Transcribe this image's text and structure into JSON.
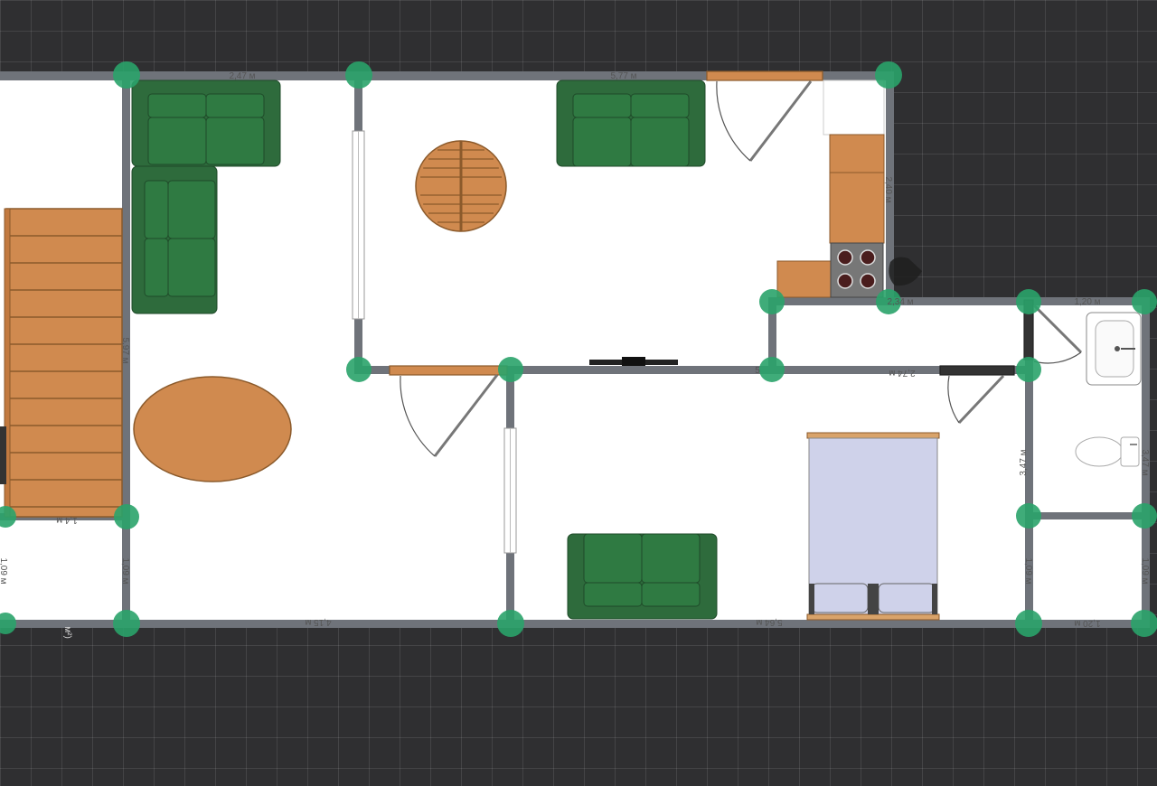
{
  "plan": {
    "dimensions": {
      "living_top": "2,47 м",
      "kitchen_top": "5,77 м",
      "kitchen_right": "2,40 м",
      "kitchen_bottom": "2,34 м",
      "bath_top": "1,20 м",
      "living_right": "5,97 м",
      "corridor": "2,74 м",
      "corridor_small": "5",
      "bedroom_left": "3,47 м",
      "bath_right": "3,47 м",
      "left_small_left": "1,09 м",
      "left_small_right": "1,09 м",
      "right_small_left": "1,09 м",
      "right_small_right": "1,09 м",
      "bottom_left": "4,15 м",
      "bottom_mid": "5,64 м",
      "bottom_right": "1,20 м",
      "stair_bottom": "1,4 м",
      "area_fragment": "м²)"
    },
    "colors": {
      "wall": "#6f737a",
      "floor": "#ffffff",
      "sofa": "#2e6b3c",
      "wood": "#d08a4f",
      "bed": "#cfd2ea",
      "node": "#2aa36a"
    }
  }
}
